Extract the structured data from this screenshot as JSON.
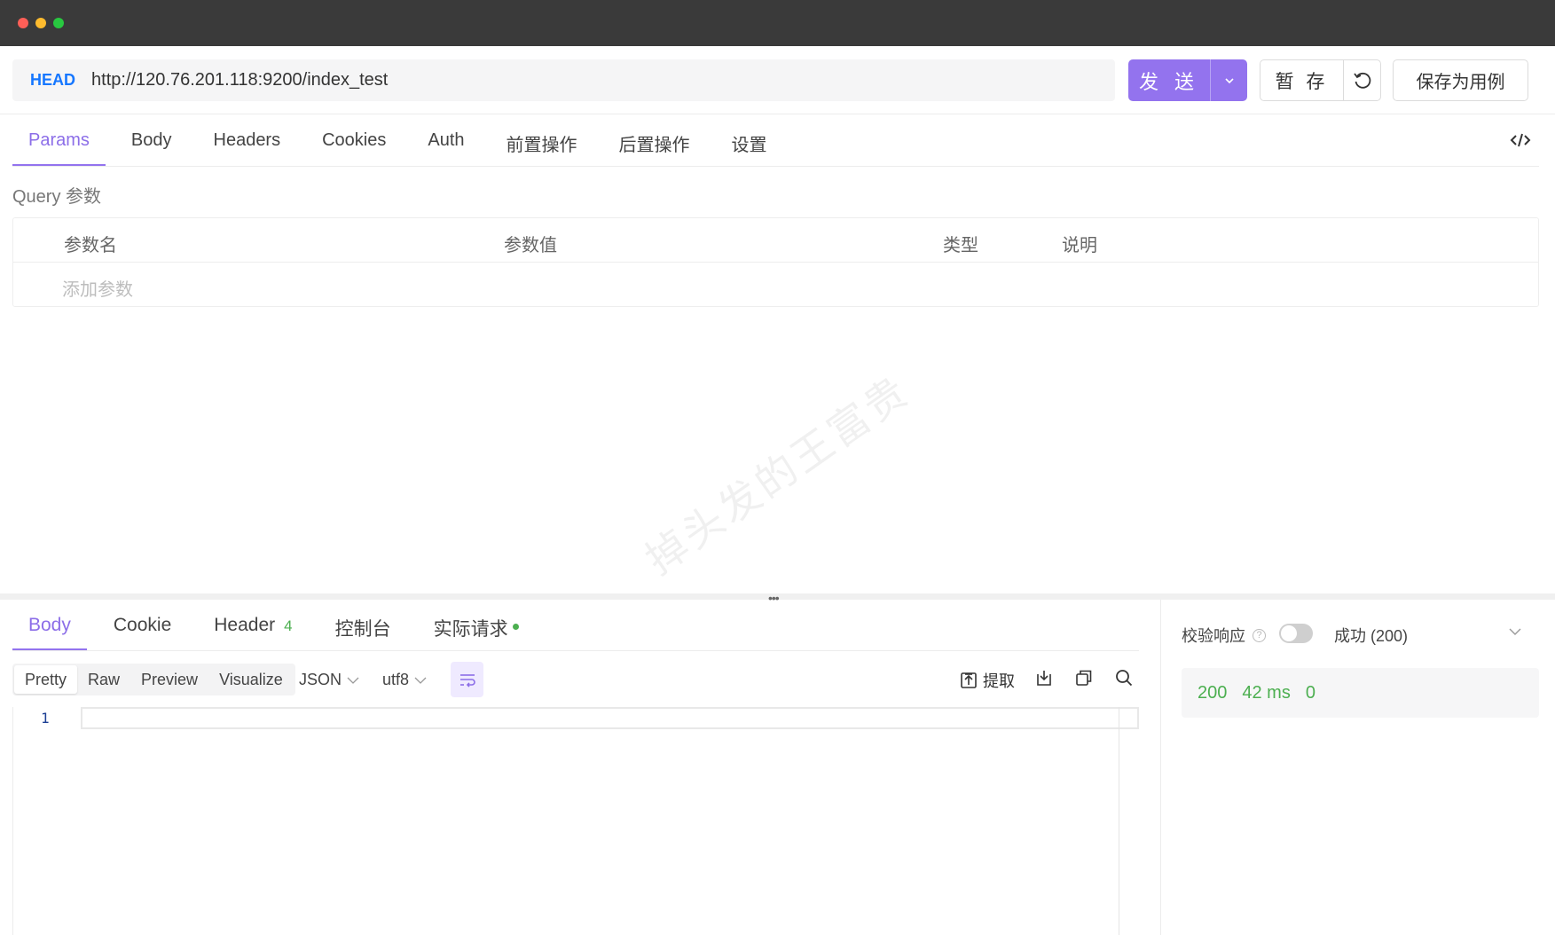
{
  "request": {
    "method": "HEAD",
    "url": "http://120.76.201.118:9200/index_test",
    "send_label": "发 送",
    "save_label": "暂 存",
    "save_case_label": "保存为用例"
  },
  "request_tabs": [
    "Params",
    "Body",
    "Headers",
    "Cookies",
    "Auth",
    "前置操作",
    "后置操作",
    "设置"
  ],
  "params": {
    "section_label": "Query 参数",
    "columns": [
      "参数名",
      "参数值",
      "类型",
      "说明"
    ],
    "add_placeholder": "添加参数"
  },
  "watermark": "掉头发的王富贵",
  "response_tabs": {
    "body": "Body",
    "cookie": "Cookie",
    "header": "Header",
    "header_count": "4",
    "console": "控制台",
    "actual_request": "实际请求"
  },
  "response_view": {
    "modes": [
      "Pretty",
      "Raw",
      "Preview",
      "Visualize"
    ],
    "format": "JSON",
    "encoding": "utf8",
    "extract_label": "提取",
    "line_number": "1"
  },
  "verify": {
    "label": "校验响应",
    "help": "?",
    "status_option": "成功 (200)",
    "enabled": false
  },
  "stats": {
    "status_code": "200",
    "time": "42 ms",
    "size": "0"
  },
  "colors": {
    "accent": "#9373ee",
    "method": "#1677ff",
    "success": "#4caf50"
  }
}
